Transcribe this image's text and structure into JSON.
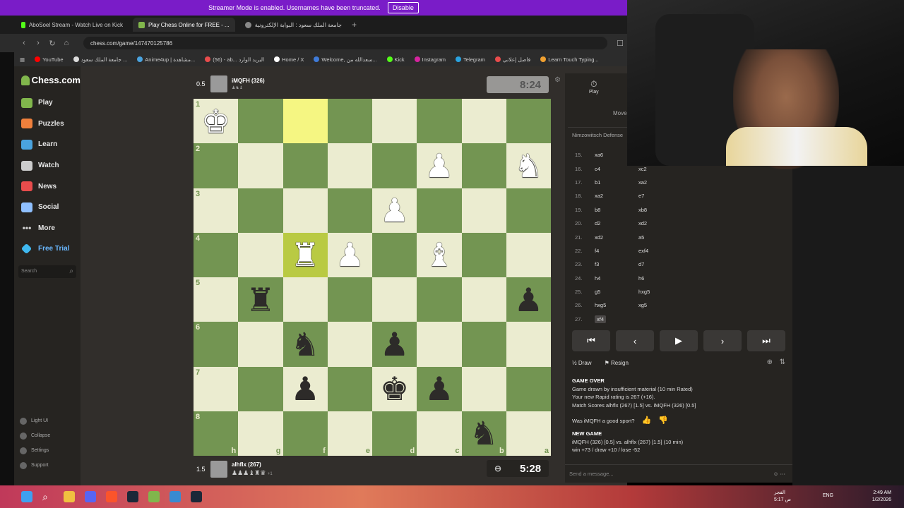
{
  "banner": {
    "text": "Streamer Mode is enabled. Usernames have been truncated.",
    "button": "Disable"
  },
  "tabs": [
    {
      "label": "AboSoel Stream - Watch Live on Kick",
      "color": "#53fc18"
    },
    {
      "label": "Play Chess Online for FREE - ...",
      "color": "#81b64c"
    },
    {
      "label": "جامعة الملك سعود : البوابة الإلكترونية",
      "color": "#888888"
    }
  ],
  "tab_new": "+",
  "address": {
    "url": "chess.com/game/147470125786"
  },
  "bookmarks": [
    "YouTube",
    "جامعة الملك سعود ...",
    "Anime4up | مشاهدة...",
    "(56) - ab... البريد الوارد",
    "Home / X",
    "Welcome, سعدالله من...",
    "Kick",
    "Instagram",
    "Telegram",
    "فاصل إعلاني",
    "Learn Touch Typing..."
  ],
  "sidebar": {
    "logo": "Chess.com",
    "items": [
      {
        "label": "Play",
        "color": "#81b64c"
      },
      {
        "label": "Puzzles",
        "color": "#f0803c"
      },
      {
        "label": "Learn",
        "color": "#4aa3df"
      },
      {
        "label": "Watch",
        "color": "#cccccc"
      },
      {
        "label": "News",
        "color": "#e94c4c"
      },
      {
        "label": "Social",
        "color": "#8fc0ff"
      },
      {
        "label": "More",
        "color": "#cccccc"
      },
      {
        "label": "Free Trial",
        "color": "#3fb8f0"
      }
    ],
    "search_placeholder": "Search",
    "bottom": [
      "Light UI",
      "Collapse",
      "Settings",
      "Support"
    ]
  },
  "top_player": {
    "score": "0.5",
    "name": "iMQFH (326)",
    "clock": "8:24"
  },
  "bottom_player": {
    "score": "1.5",
    "name": "alhflx (267)",
    "material": "+1",
    "clock": "5:28"
  },
  "board": {
    "ranks": [
      "1",
      "2",
      "3",
      "4",
      "5",
      "6",
      "7",
      "8"
    ],
    "files": [
      "h",
      "g",
      "f",
      "e",
      "d",
      "c",
      "b",
      "a"
    ],
    "rows": [
      [
        "wK",
        "",
        "",
        "",
        "",
        "",
        "",
        ""
      ],
      [
        "",
        "",
        "",
        "",
        "",
        "wP",
        "",
        "wN"
      ],
      [
        "",
        "",
        "",
        "",
        "wP",
        "",
        "",
        ""
      ],
      [
        "",
        "",
        "wR",
        "wP",
        "",
        "wB",
        "",
        ""
      ],
      [
        "",
        "bR",
        "",
        "",
        "",
        "",
        "",
        "bP"
      ],
      [
        "",
        "",
        "bN",
        "",
        "bP",
        "",
        "",
        ""
      ],
      [
        "",
        "",
        "bP",
        "",
        "bK",
        "bP",
        "",
        ""
      ],
      [
        "",
        "",
        "",
        "",
        "",
        "",
        "bN",
        ""
      ]
    ],
    "highlights": [
      [
        0,
        2
      ],
      [
        3,
        2
      ]
    ]
  },
  "panel": {
    "play_label": "Play",
    "moves_tab": "Moves",
    "opening": "Nimzowitsch Defense",
    "moves": [
      {
        "no": "15.",
        "w": "xa6",
        "b": ""
      },
      {
        "no": "16.",
        "w": "c4",
        "b": "xc2"
      },
      {
        "no": "17.",
        "w": "b1",
        "b": "xa2"
      },
      {
        "no": "18.",
        "w": "xa2",
        "b": "e7"
      },
      {
        "no": "19.",
        "w": "b8",
        "b": "xb8"
      },
      {
        "no": "20.",
        "w": "d2",
        "b": "xd2"
      },
      {
        "no": "21.",
        "w": "xd2",
        "b": "a5"
      },
      {
        "no": "22.",
        "w": "f4",
        "b": "exf4"
      },
      {
        "no": "23.",
        "w": "f3",
        "b": "d7"
      },
      {
        "no": "24.",
        "w": "h4",
        "b": "h6"
      },
      {
        "no": "25.",
        "w": "g5",
        "b": "hxg5"
      },
      {
        "no": "26.",
        "w": "hxg5",
        "b": "xg5"
      },
      {
        "no": "27.",
        "w": "xf4",
        "b": ""
      }
    ],
    "draw": "Draw",
    "resign": "Resign",
    "game_over": "GAME OVER",
    "line1": "Game drawn by insufficient material (10 min Rated)",
    "line2": "Your new Rapid rating is 267 (+16).",
    "line3": "Match Scores alhflx (267) [1.5] vs. iMQFH (326) [0.5]",
    "good_sport": "Was iMQFH a good sport?",
    "new_game": "NEW GAME",
    "line4": "iMQFH (326) [0.5] vs. alhflx (267) [1.5] (10 min)",
    "line5": "win +73 / draw +10 / lose -52",
    "message_placeholder": "Send a message..."
  },
  "taskbar": {
    "clock_time": "2:49 AM",
    "clock_date": "1/2/2026",
    "lang": "ENG",
    "weather": "الفجر",
    "weather_time": "5:17 ص"
  }
}
